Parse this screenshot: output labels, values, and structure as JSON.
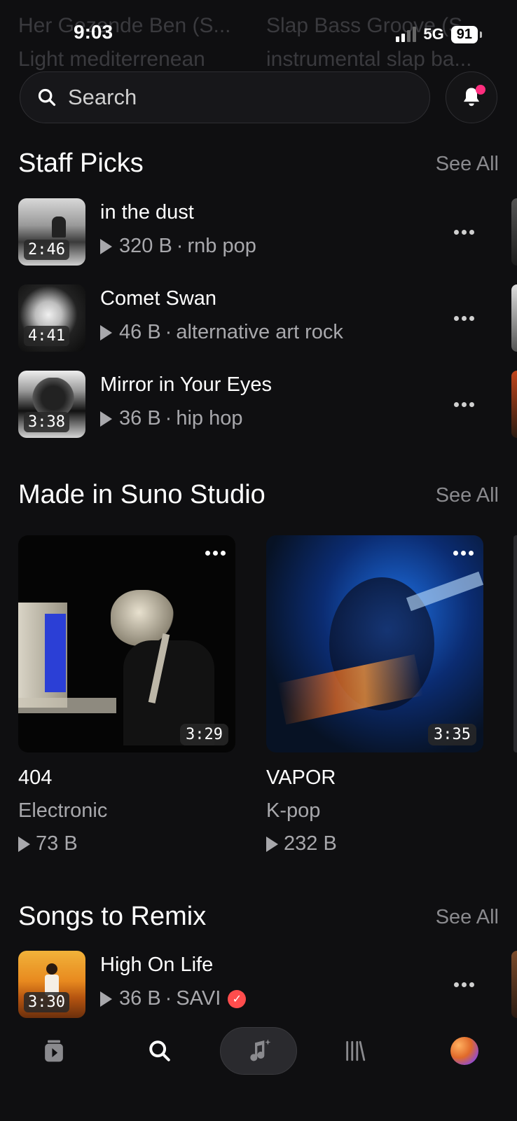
{
  "background_ghost": {
    "left_title": "Her Gezende Ben (S...",
    "left_sub": "Light mediterrenean",
    "right_title": "Slap Bass Groove (S...",
    "right_sub": "instrumental slap ba..."
  },
  "status_bar": {
    "time": "9:03",
    "network": "5G",
    "battery": "91"
  },
  "search": {
    "placeholder": "Search",
    "icon": "search-icon"
  },
  "notifications": {
    "icon": "bell-icon",
    "has_unread": true
  },
  "colors": {
    "accent": "#ff2e7e",
    "background": "#0f0f11",
    "muted": "#8a8a8e"
  },
  "staff_picks": {
    "title": "Staff Picks",
    "see_all": "See All",
    "items": [
      {
        "title": "in the dust",
        "duration": "2:46",
        "plays": "320 B",
        "sep": "·",
        "genre": "rnb pop"
      },
      {
        "title": "Comet Swan",
        "duration": "4:41",
        "plays": "46 B",
        "sep": "·",
        "genre": "alternative art rock"
      },
      {
        "title": "Mirror in Your Eyes",
        "duration": "3:38",
        "plays": "36 B",
        "sep": "·",
        "genre": "hip hop"
      }
    ]
  },
  "made_in_studio": {
    "title": "Made in Suno Studio",
    "see_all": "See All",
    "cards": [
      {
        "title": "404",
        "genre": "Electronic",
        "plays": "73 B",
        "duration": "3:29"
      },
      {
        "title": "VAPOR",
        "genre": "K-pop",
        "plays": "232 B",
        "duration": "3:35"
      }
    ]
  },
  "songs_to_remix": {
    "title": "Songs to Remix",
    "see_all": "See All",
    "items": [
      {
        "title": "High On Life",
        "duration": "3:30",
        "plays": "36 B",
        "sep": "·",
        "artist": "SAVI",
        "verified": true
      }
    ]
  },
  "tab_bar": {
    "tabs": [
      {
        "name": "library-play-icon"
      },
      {
        "name": "search-icon"
      },
      {
        "name": "create-music-icon"
      },
      {
        "name": "library-icon"
      },
      {
        "name": "profile-avatar"
      }
    ]
  }
}
